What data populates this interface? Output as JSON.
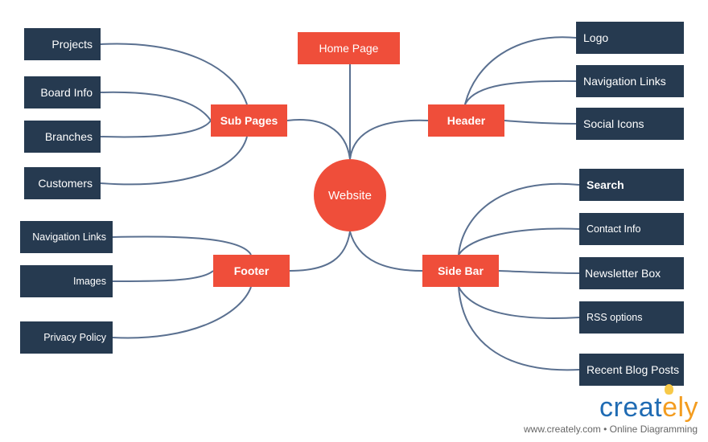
{
  "diagram": {
    "center": "Website",
    "home_page": "Home Page",
    "sub_pages": {
      "label": "Sub Pages",
      "children": [
        "Projects",
        "Board Info",
        "Branches",
        "Customers"
      ]
    },
    "header": {
      "label": "Header",
      "children": [
        "Logo",
        "Navigation Links",
        "Social Icons"
      ]
    },
    "footer": {
      "label": "Footer",
      "children": [
        "Navigation Links",
        "Images",
        "Privacy Policy"
      ]
    },
    "side_bar": {
      "label": "Side Bar",
      "children": [
        "Search",
        "Contact Info",
        "Newsletter Box",
        "RSS options",
        "Recent Blog Posts"
      ]
    }
  },
  "colors": {
    "branch": "#ef4e3a",
    "leaf": "#263a50",
    "connector": "#5a7090"
  },
  "branding": {
    "logo_text_main": "creat",
    "logo_text_accent": "ely",
    "tagline": "www.creately.com • Online Diagramming"
  }
}
